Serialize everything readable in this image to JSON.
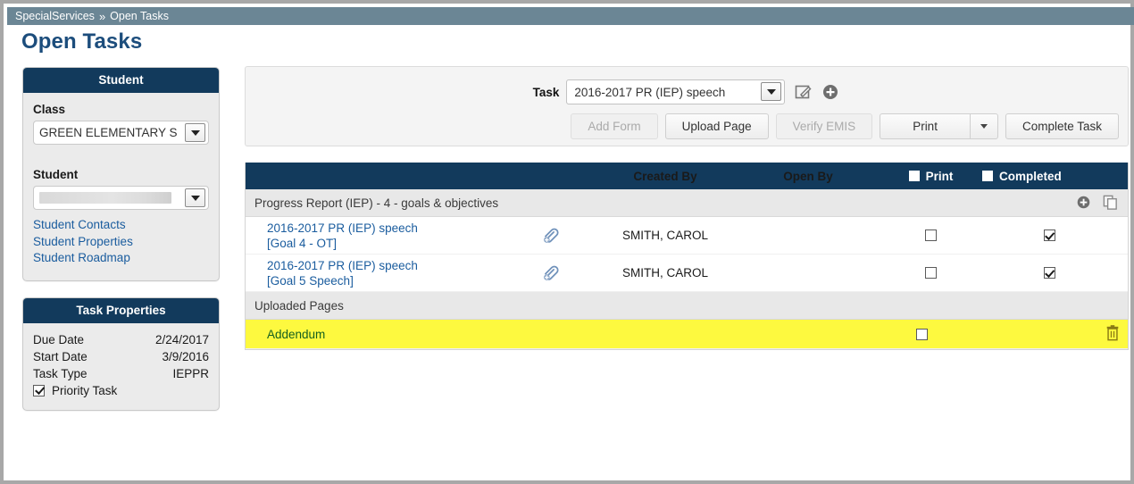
{
  "breadcrumb": {
    "root": "SpecialServices",
    "separator": "»",
    "current": "Open Tasks"
  },
  "page": {
    "title": "Open Tasks"
  },
  "sidebar": {
    "student_panel": {
      "title": "Student",
      "class_label": "Class",
      "class_value": "GREEN ELEMENTARY S",
      "student_label": "Student",
      "student_value": "",
      "links": [
        {
          "label": "Student Contacts"
        },
        {
          "label": "Student Properties"
        },
        {
          "label": "Student Roadmap"
        }
      ]
    },
    "task_properties": {
      "title": "Task Properties",
      "rows": [
        {
          "label": "Due Date",
          "value": "2/24/2017"
        },
        {
          "label": "Start Date",
          "value": "3/9/2016"
        },
        {
          "label": "Task Type",
          "value": "IEPPR"
        }
      ],
      "priority_label": "Priority Task",
      "priority_checked": true
    }
  },
  "toolbar": {
    "task_label": "Task",
    "task_value": "2016-2017 PR (IEP) speech",
    "edit_icon": "edit-pencil-icon",
    "add_icon": "add-circle-icon",
    "buttons": {
      "add_form": "Add Form",
      "upload_page": "Upload Page",
      "verify_emis": "Verify EMIS",
      "print": "Print",
      "complete_task": "Complete Task"
    }
  },
  "table": {
    "headers": {
      "created_by": "Created By",
      "open_by": "Open By",
      "print": "Print",
      "completed": "Completed"
    },
    "groups": [
      {
        "name": "Progress Report (IEP) - 4 - goals & objectives",
        "icons": [
          "add-circle-icon",
          "copy-pages-icon"
        ],
        "rows": [
          {
            "title": "2016-2017 PR (IEP) speech",
            "subtitle": "[Goal 4 - OT]",
            "attachment_icon": "paperclip-add-icon",
            "created_by": "SMITH, CAROL",
            "open_by": "",
            "print_checked": false,
            "completed_checked": true
          },
          {
            "title": "2016-2017 PR (IEP) speech",
            "subtitle": "[Goal 5 Speech]",
            "attachment_icon": "paperclip-add-icon",
            "created_by": "SMITH, CAROL",
            "open_by": "",
            "print_checked": false,
            "completed_checked": true
          }
        ]
      },
      {
        "name": "Uploaded Pages",
        "icons": [],
        "rows": [
          {
            "title": "Addendum",
            "subtitle": "",
            "attachment_icon": "",
            "created_by": "",
            "open_by": "",
            "print_checked": false,
            "completed_checked": null,
            "highlight": true,
            "delete_icon": "trash-icon"
          }
        ]
      }
    ]
  },
  "colors": {
    "breadcrumb_bar": "#6b8695",
    "panel_header": "#123a5c",
    "title": "#1c4d7c",
    "link": "#1a5c9e",
    "highlight_row": "#fdf93f",
    "highlight_text": "#14601f"
  }
}
